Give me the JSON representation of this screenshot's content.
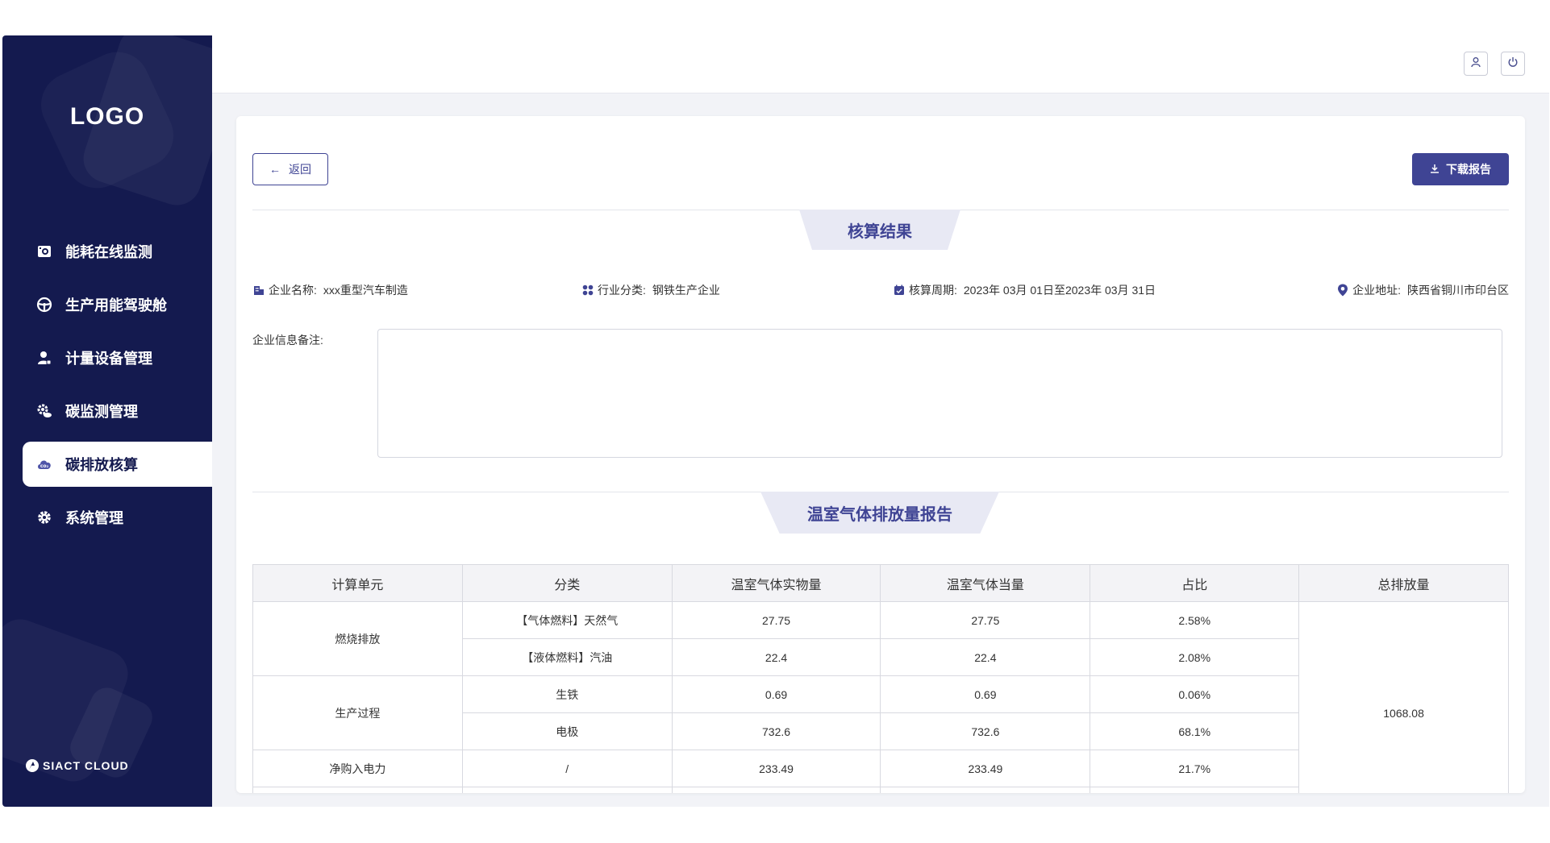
{
  "sidebar": {
    "logo": "LOGO",
    "items": [
      {
        "label": "能耗在线监测",
        "icon": "camera-monitor-icon"
      },
      {
        "label": "生产用能驾驶舱",
        "icon": "steering-wheel-icon"
      },
      {
        "label": "计量设备管理",
        "icon": "user-device-icon"
      },
      {
        "label": "碳监测管理",
        "icon": "gear-cloud-icon"
      },
      {
        "label": "碳排放核算",
        "icon": "co2-cloud-icon",
        "active": true
      },
      {
        "label": "系统管理",
        "icon": "gear-icon"
      }
    ],
    "brand": "SIACT CLOUD"
  },
  "topbar": {
    "user_icon": "user-icon",
    "power_icon": "power-icon"
  },
  "toolbar": {
    "back_label": "返回",
    "download_label": "下载报告"
  },
  "sections": {
    "result_title": "核算结果",
    "report_title": "温室气体排放量报告"
  },
  "info": {
    "company_label": "企业名称:",
    "company_value": "xxx重型汽车制造",
    "industry_label": "行业分类:",
    "industry_value": "钢铁生产企业",
    "period_label": "核算周期:",
    "period_value": "2023年 03月 01日至2023年 03月 31日",
    "address_label": "企业地址:",
    "address_value": "陕西省铜川市印台区",
    "note_label": "企业信息备注:"
  },
  "table": {
    "headers": [
      "计算单元",
      "分类",
      "温室气体实物量",
      "温室气体当量",
      "占比",
      "总排放量"
    ],
    "groups": {
      "combustion": "燃烧排放",
      "process": "生产过程",
      "power": "净购入电力"
    },
    "rows": [
      {
        "category": "【气体燃料】天然气",
        "physical": "27.75",
        "equivalent": "27.75",
        "ratio": "2.58%"
      },
      {
        "category": "【液体燃料】汽油",
        "physical": "22.4",
        "equivalent": "22.4",
        "ratio": "2.08%"
      },
      {
        "category": "生铁",
        "physical": "0.69",
        "equivalent": "0.69",
        "ratio": "0.06%"
      },
      {
        "category": "电极",
        "physical": "732.6",
        "equivalent": "732.6",
        "ratio": "68.1%"
      },
      {
        "category": "/",
        "physical": "233.49",
        "equivalent": "233.49",
        "ratio": "21.7%"
      }
    ],
    "total": "1068.08"
  },
  "colors": {
    "sidebar_bg": "#141a4f",
    "accent": "#3f4494",
    "section_bg": "#e8e9f4"
  }
}
